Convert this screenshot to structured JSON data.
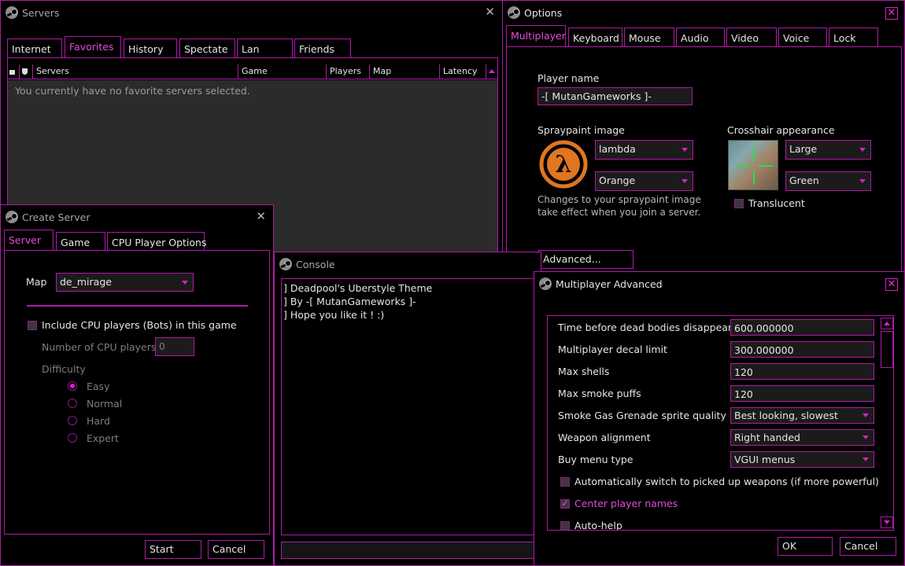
{
  "colors": {
    "accent": "#d81fce",
    "border": "#b01aa8",
    "background": "#000000",
    "field_bg": "#1b1b1b",
    "active_tab_text": "#e84ad8"
  },
  "servers": {
    "title": "Servers",
    "tabs": [
      "Internet",
      "Favorites",
      "History",
      "Spectate",
      "Lan",
      "Friends"
    ],
    "active_tab": "Favorites",
    "columns": [
      "Servers",
      "Game",
      "Players",
      "Map",
      "Latency"
    ],
    "lock_icon": "lock-icon",
    "shield_icon": "shield-icon",
    "empty_message": "You currently have no favorite servers selected."
  },
  "options": {
    "title": "Options",
    "tabs": [
      "Multiplayer",
      "Keyboard",
      "Mouse",
      "Audio",
      "Video",
      "Voice",
      "Lock"
    ],
    "active_tab": "Multiplayer",
    "player_name_label": "Player name",
    "player_name_value": "-[ MutanGameworks ]-",
    "spraypaint_label": "Spraypaint image",
    "spray_image_value": "lambda",
    "spray_color_value": "Orange",
    "spray_note": "Changes to your spraypaint image take effect when you join a server.",
    "crosshair_label": "Crosshair appearance",
    "crosshair_size_value": "Large",
    "crosshair_color_value": "Green",
    "translucent_label": "Translucent",
    "translucent_checked": false,
    "advanced_button": "Advanced..."
  },
  "create_server": {
    "title": "Create Server",
    "tabs": [
      "Server",
      "Game",
      "CPU Player Options"
    ],
    "active_tab": "Server",
    "map_label": "Map",
    "map_value": "de_mirage",
    "include_bots_label": "Include CPU players (Bots) in this game",
    "include_bots_checked": false,
    "num_cpu_label": "Number of CPU players",
    "num_cpu_value": "0",
    "difficulty_label": "Difficulty",
    "difficulties": [
      "Easy",
      "Normal",
      "Hard",
      "Expert"
    ],
    "selected_difficulty": "Easy",
    "start_button": "Start",
    "cancel_button": "Cancel"
  },
  "console": {
    "title": "Console",
    "lines": [
      "] Deadpool's Uberstyle Theme",
      "] By -[ MutanGameworks ]-",
      "] Hope you like it ! :)"
    ]
  },
  "mp_advanced": {
    "title": "Multiplayer Advanced",
    "dead_bodies_label": "Time before dead bodies disappear",
    "dead_bodies_value": "600.000000",
    "decal_limit_label": "Multiplayer decal limit",
    "decal_limit_value": "300.000000",
    "max_shells_label": "Max shells",
    "max_shells_value": "120",
    "max_smoke_label": "Max smoke puffs",
    "max_smoke_value": "120",
    "smoke_quality_label": "Smoke Gas Grenade sprite quality",
    "smoke_quality_value": "Best looking, slowest",
    "weapon_alignment_label": "Weapon alignment",
    "weapon_alignment_value": "Right handed",
    "buy_menu_label": "Buy menu type",
    "buy_menu_value": "VGUI menus",
    "auto_switch_label": "Automatically switch to picked up weapons (if more powerful)",
    "auto_switch_checked": false,
    "center_names_label": "Center player names",
    "center_names_checked": true,
    "auto_help_label": "Auto-help",
    "auto_help_checked": false,
    "ok_button": "OK",
    "cancel_button": "Cancel"
  }
}
